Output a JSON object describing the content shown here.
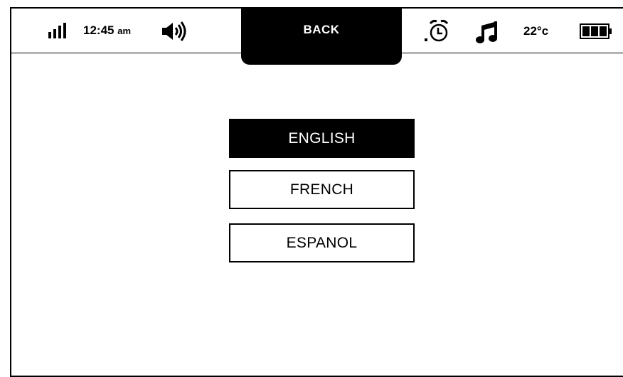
{
  "status_bar": {
    "time": "12:45",
    "time_suffix": "am",
    "temperature": "22°c",
    "icons": [
      "signal-icon",
      "volume-icon",
      "alarm-icon",
      "music-icon",
      "battery-icon"
    ]
  },
  "back_button": {
    "label": "BACK"
  },
  "languages": [
    {
      "label": "ENGLISH",
      "selected": true
    },
    {
      "label": "FRENCH",
      "selected": false
    },
    {
      "label": "ESPANOL",
      "selected": false
    }
  ],
  "colors": {
    "foreground": "#000000",
    "background": "#ffffff"
  }
}
